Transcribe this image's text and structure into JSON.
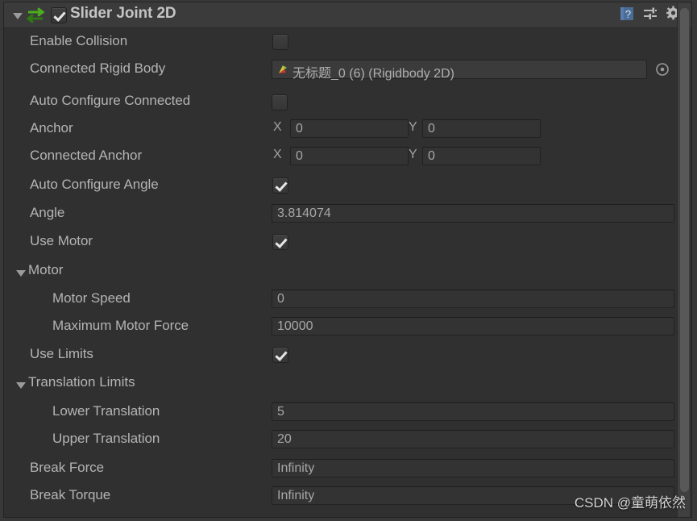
{
  "component": {
    "title": "Slider Joint 2D",
    "enabled": true,
    "icon": "joint-2d-icon",
    "expanded": true
  },
  "header_icons": {
    "help": "help-book-icon",
    "preset": "preset-sliders-icon",
    "settings": "gear-dropdown-icon"
  },
  "rows": {
    "enable_collision": {
      "label": "Enable Collision",
      "checked": false
    },
    "connected_rigid_body": {
      "label": "Connected Rigid Body",
      "value": "无标题_0 (6) (Rigidbody 2D)",
      "icon": "rigidbody-2d-icon",
      "picker": "object-picker-icon"
    },
    "auto_configure_connected": {
      "label": "Auto Configure Connected",
      "checked": false
    },
    "anchor": {
      "label": "Anchor",
      "x_label": "X",
      "x": "0",
      "y_label": "Y",
      "y": "0"
    },
    "connected_anchor": {
      "label": "Connected Anchor",
      "x_label": "X",
      "x": "0",
      "y_label": "Y",
      "y": "0"
    },
    "auto_configure_angle": {
      "label": "Auto Configure Angle",
      "checked": true
    },
    "angle": {
      "label": "Angle",
      "value": "3.814074"
    },
    "use_motor": {
      "label": "Use Motor",
      "checked": true
    },
    "motor_group": {
      "label": "Motor",
      "expanded": true
    },
    "motor_speed": {
      "label": "Motor Speed",
      "value": "0"
    },
    "maximum_motor_force": {
      "label": "Maximum Motor Force",
      "value": "10000"
    },
    "use_limits": {
      "label": "Use Limits",
      "checked": true
    },
    "translation_limits_group": {
      "label": "Translation Limits",
      "expanded": true
    },
    "lower_translation": {
      "label": "Lower Translation",
      "value": "5"
    },
    "upper_translation": {
      "label": "Upper Translation",
      "value": "20"
    },
    "break_force": {
      "label": "Break Force",
      "value": "Infinity"
    },
    "break_torque": {
      "label": "Break Torque",
      "value": "Infinity"
    }
  },
  "watermark": "CSDN @童萌依然",
  "colors": {
    "panel_bg": "#303030",
    "header_bg": "#3b3b3b",
    "label_text": "#b4b4b4",
    "value_text": "#a7a7a7",
    "field_bg": "#333333",
    "joint_icon_green": "#4caf1e"
  }
}
